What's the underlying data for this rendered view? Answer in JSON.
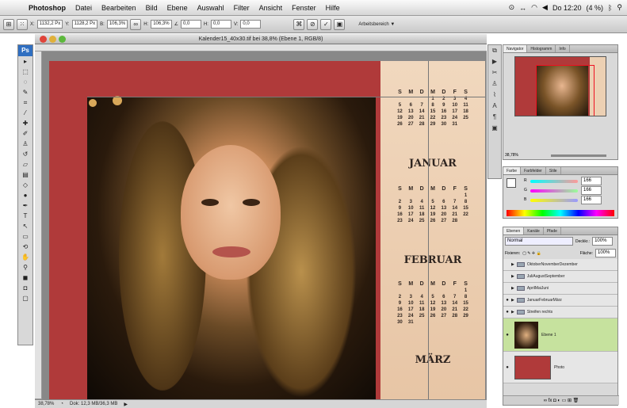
{
  "menubar": {
    "app_name": "Photoshop",
    "items": [
      "Datei",
      "Bearbeiten",
      "Bild",
      "Ebene",
      "Auswahl",
      "Filter",
      "Ansicht",
      "Fenster",
      "Hilfe"
    ],
    "clock": "Do 12:20",
    "battery": "(4 %)"
  },
  "optionsbar": {
    "x_value": "1132,2 Px",
    "y_value": "1128,2 Px",
    "w_value": "106,3%",
    "h_value": "106,3%",
    "angle_value": "0,0",
    "h_skew": "0,0",
    "v_skew": "0,0",
    "workspace_label": "Arbeitsbereich ▼"
  },
  "document": {
    "title": "Kalender15_40x30.tif bei 38,8% (Ebene 1, RGB/8)",
    "zoom": "38,78%",
    "doc_info": "Dok: 12,3 MB/36,3 MB"
  },
  "calendar": {
    "months": [
      "JANUAR",
      "FEBRUAR",
      "MÄRZ"
    ],
    "weekday_headers": [
      "S",
      "M",
      "D",
      "M",
      "D",
      "F",
      "S"
    ],
    "january_days": [
      "",
      "",
      "",
      "1",
      "2",
      "3",
      "4",
      "5",
      "6",
      "7",
      "8",
      "9",
      "10",
      "11",
      "12",
      "13",
      "14",
      "15",
      "16",
      "17",
      "18",
      "19",
      "20",
      "21",
      "22",
      "23",
      "24",
      "25",
      "26",
      "27",
      "28",
      "29",
      "30",
      "31",
      ""
    ],
    "february_days": [
      "",
      "",
      "",
      "",
      "",
      "",
      "1",
      "2",
      "3",
      "4",
      "5",
      "6",
      "7",
      "8",
      "9",
      "10",
      "11",
      "12",
      "13",
      "14",
      "15",
      "16",
      "17",
      "18",
      "19",
      "20",
      "21",
      "22",
      "23",
      "24",
      "25",
      "26",
      "27",
      "28"
    ],
    "march_days": [
      "",
      "",
      "",
      "",
      "",
      "",
      "1",
      "2",
      "3",
      "4",
      "5",
      "6",
      "7",
      "8",
      "9",
      "10",
      "11",
      "12",
      "13",
      "14",
      "15",
      "16",
      "17",
      "18",
      "19",
      "20",
      "21",
      "22",
      "23",
      "24",
      "25",
      "26",
      "27",
      "28",
      "29",
      "30",
      "31"
    ]
  },
  "tools": [
    "move",
    "marquee",
    "lasso",
    "quick-select",
    "crop",
    "eyedropper",
    "healing",
    "brush",
    "stamp",
    "history-brush",
    "eraser",
    "gradient",
    "blur",
    "dodge",
    "pen",
    "type",
    "path-select",
    "shape",
    "hand",
    "zoom"
  ],
  "navigator": {
    "tabs": [
      "Navigator",
      "Histogramm",
      "Info"
    ],
    "zoom": "38,78%"
  },
  "color_panel": {
    "tabs": [
      "Farbe",
      "Farbfelder",
      "Stile"
    ],
    "r_label": "R",
    "g_label": "G",
    "b_label": "B",
    "r": "166",
    "g": "166",
    "b": "166"
  },
  "layers": {
    "tabs": [
      "Ebenen",
      "Kanäle",
      "Pfade"
    ],
    "blend_mode": "Normal",
    "opacity_label": "Deckkr.:",
    "opacity": "100%",
    "lock_label": "Fixieren:",
    "fill_label": "Fläche:",
    "fill": "100%",
    "rows": [
      {
        "name": "OktoberNovemberDezember"
      },
      {
        "name": "JuliAugustSeptember"
      },
      {
        "name": "AprilMaiJuni"
      },
      {
        "name": "JanuarFebruarMärz"
      },
      {
        "name": "Streifen rechts"
      }
    ],
    "image_layer": "Ebene 1",
    "bg_layer": "Photo"
  },
  "colors": {
    "accent_red": "#b03a3a",
    "calendar_bg": "#ecd0b3",
    "selected_layer": "#c6e29e"
  }
}
